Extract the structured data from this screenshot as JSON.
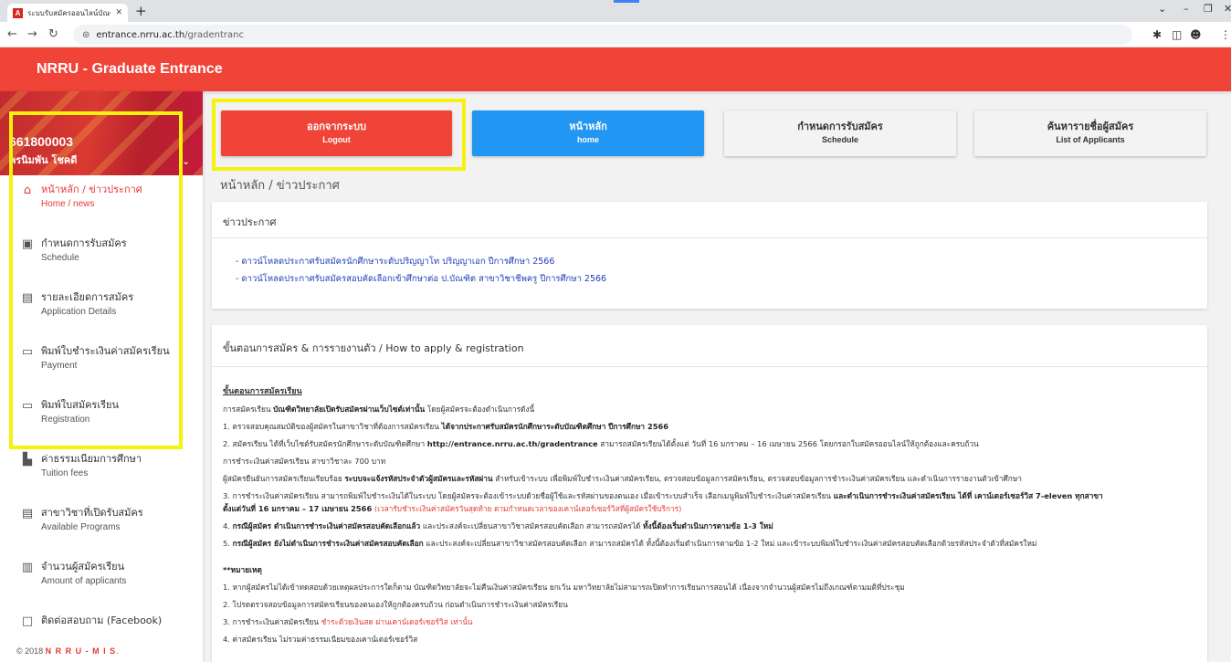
{
  "browser": {
    "tab_title": "ระบบรับสมัครออนไลน์บัณฑิตวิทยาลัยมห",
    "tab_favicon": "A",
    "url_host": "entrance.nrru.ac.th",
    "url_path": "/gradentranc"
  },
  "site": {
    "title": "NRRU - Graduate Entrance"
  },
  "profile": {
    "id": "661800003",
    "name": "พรนิมพัน โชคดี"
  },
  "sidebar": {
    "items": [
      {
        "icon": "home-icon",
        "label": "หน้าหลัก / ข่าวประกาศ",
        "sub": "Home / news"
      },
      {
        "icon": "id-card-icon",
        "label": "กำหนดการรับสมัคร",
        "sub": "Schedule"
      },
      {
        "icon": "form-icon",
        "label": "รายละเอียดการสมัคร",
        "sub": "Application Details"
      },
      {
        "icon": "credit-card-icon",
        "label": "พิมพ์ใบชำระเงินค่าสมัครเรียน",
        "sub": "Payment"
      },
      {
        "icon": "credit-card-icon",
        "label": "พิมพ์ใบสมัครเรียน",
        "sub": "Registration"
      },
      {
        "icon": "folder-icon",
        "label": "ค่าธรรมเนียมการศึกษา",
        "sub": "Tuition fees"
      },
      {
        "icon": "form-icon",
        "label": "สาขาวิชาที่เปิดรับสมัคร",
        "sub": "Available Programs"
      },
      {
        "icon": "bar-chart-icon",
        "label": "จำนวนผู้สมัครเรียน",
        "sub": "Amount of applicants"
      },
      {
        "icon": "chat-icon",
        "label": "ติดต่อสอบถาม (Facebook)",
        "sub": ""
      }
    ],
    "footer_prefix": "© 2018",
    "footer_brand": "N R R U - M I S",
    "footer_suffix": "."
  },
  "top_buttons": [
    {
      "th": "ออกจากระบบ",
      "en": "Logout"
    },
    {
      "th": "หน้าหลัก",
      "en": "home"
    },
    {
      "th": "กำหนดการรับสมัคร",
      "en": "Schedule"
    },
    {
      "th": "ค้นหารายชื่อผู้สมัคร",
      "en": "List of Applicants"
    }
  ],
  "page_heading": "หน้าหลัก / ข่าวประกาศ",
  "news": {
    "title": "ข่าวประกาศ",
    "links": [
      "- ดาวน์โหลดประกาศรับสมัครนักศึกษาระดับปริญญาโท ปริญญาเอก ปีการศึกษา 2566",
      "- ดาวน์โหลดประกาศรับสมัครสอบคัดเลือกเข้าศึกษาต่อ ป.บัณฑิต สาขาวิชาชีพครู ปีการศึกษา 2566"
    ]
  },
  "steps": {
    "title": "ขั้นตอนการสมัคร & การรายงานตัว / How to apply & registration",
    "heading": "ขั้นตอนการสมัครเรียน",
    "intro_a": "การสมัครเรียน ",
    "intro_b": "บัณฑิตวิทยาลัยเปิดรับสมัครผ่านเว็บไซต์เท่านั้น",
    "intro_c": " โดยผู้สมัครจะต้องดำเนินการดังนี้",
    "s1_a": "1. ตรวจสอบคุณสมบัติของผู้สมัครในสาขาวิชาที่ต้องการสมัครเรียน ",
    "s1_b": "ได้จากประกาศรับสมัครนักศึกษาระดับบัณฑิตศึกษา ปีการศึกษา 2566",
    "s2_a": "2. สมัครเรียน ได้ที่เว็บไซต์รับสมัครนักศึกษาระดับบัณฑิตศึกษา ",
    "s2_b": "http://entrance.nrru.ac.th/gradentrance",
    "s2_c": " สามารถสมัครเรียนได้ตั้งแต่ วันที่ 16 มกราคม – 16 เมษายน 2566 โดยกรอกใบสมัครออนไลน์ให้ถูกต้องและครบถ้วน",
    "fee": "การชำระเงินค่าสมัครเรียน สาขาวิชาละ 700 บาท",
    "confirm_a": "ผู้สมัครยืนยันการสมัครเรียนเรียบร้อย ",
    "confirm_b": "ระบบจะแจ้งรหัสประจำตัวผู้สมัครและรหัสผ่าน",
    "confirm_c": " สำหรับเข้าระบบ เพื่อพิมพ์ใบชำระเงินค่าสมัครเรียน, ตรวจสอบข้อมูลการสมัครเรียน, ตรวจสอบข้อมูลการชำระเงินค่าสมัครเรียน และดำเนินการรายงานตัวเข้าศึกษา",
    "s3_a": "3. การชำระเงินค่าสมัครเรียน สามารถพิมพ์ใบชำระเงินได้ในระบบ โดยผู้สมัครจะต้องเข้าระบบด้วยชื่อผู้ใช้และรหัสผ่านของตนเอง เมื่อเข้าระบบสำเร็จ เลือกเมนูพิมพ์ใบชำระเงินค่าสมัครเรียน ",
    "s3_b": "และดำเนินการชำระเงินค่าสมัครเรียน ได้ที่ เคาน์เตอร์เซอร์วิส 7-eleven ทุกสาขา",
    "s3_line2_a": "ตั้งแต่วันที่ 16 มกราคม – 17 เมษายน 2566",
    "s3_line2_b": " (เวลารับชำระเงินค่าสมัครวันสุดท้าย ตามกำหนดเวลาของเคาน์เตอร์เซอร์วิสที่ผู้สมัครใช้บริการ)",
    "s4_a": "4. ",
    "s4_b": "กรณีผู้สมัคร ดำเนินการชำระเงินค่าสมัครสอบคัดเลือกแล้ว",
    "s4_c": " และประสงค์จะเปลี่ยนสาขาวิชาสมัครสอบคัดเลือก สามารถสมัครได้ ",
    "s4_d": "ทั้งนี้ต้องเริ่มดำเนินการตามข้อ 1-3 ใหม่",
    "s5_a": "5. ",
    "s5_b": "กรณีผู้สมัคร ยังไม่ดำเนินการชำระเงินค่าสมัครสอบคัดเลือก",
    "s5_c": " และประสงค์จะเปลี่ยนสาขาวิชาสมัครสอบคัดเลือก สามารถสมัครได้ ทั้งนี้ต้องเริ่มดำเนินการตามข้อ 1-2 ใหม่ และเข้าระบบพิมพ์ใบชำระเงินค่าสมัครสอบคัดเลือกด้วยรหัสประจำตัวที่สมัครใหม่",
    "notes_heading": "**หมายเหตุ",
    "n1": "1. หากผู้สมัครไม่ได้เข้าทดสอบด้วยเหตุผลประการใดก็ตาม บัณฑิตวิทยาลัยจะไม่คืนเงินค่าสมัครเรียน ยกเว้น มหาวิทยาลัยไม่สามารถเปิดทำการเรียนการสอนได้ เนื่องจากจำนวนผู้สมัครไม่ถึงเกณฑ์ตามมติที่ประชุม",
    "n2": "2. โปรดตรวจสอบข้อมูลการสมัครเรียนของตนเองให้ถูกต้องครบถ้วน ก่อนดำเนินการชำระเงินค่าสมัครเรียน",
    "n3_a": "3. การชำระเงินค่าสมัครเรียน ",
    "n3_b": "ชำระด้วยเงินสด ผ่านเคาน์เตอร์เซอร์วิส เท่านั้น",
    "n4": "4. ค่าสมัครเรียน ไม่รวมค่าธรรมเนียมของเคาน์เตอร์เซอร์วิส"
  }
}
